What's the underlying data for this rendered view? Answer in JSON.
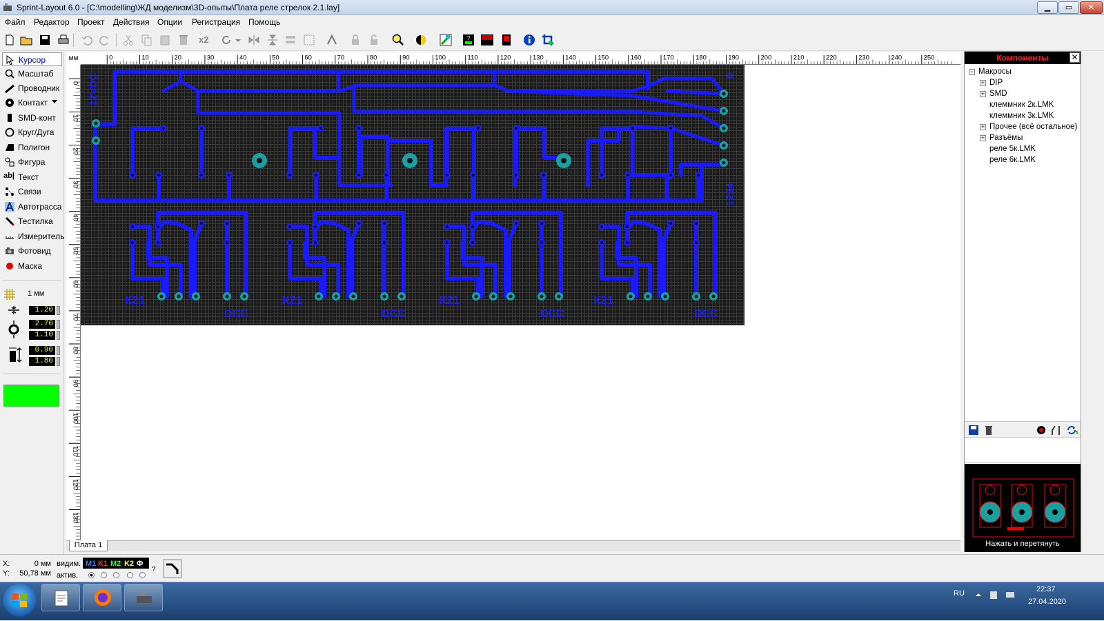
{
  "window": {
    "title": "Sprint-Layout 6.0 - [C:\\modelling\\ЖД моделизм\\3D-опыты\\Плата реле стрелок 2.1.lay]",
    "min": "▁",
    "max": "▭",
    "close": "✕"
  },
  "menu": [
    "Файл",
    "Редактор",
    "Проект",
    "Действия",
    "Опции",
    "Регистрация",
    "Помощь"
  ],
  "toolbar": {
    "zoom_factor": "x2"
  },
  "tools": [
    {
      "label": "Курсор",
      "icon": "cursor-icon",
      "selected": true
    },
    {
      "label": "Масштаб",
      "icon": "magnifier-icon"
    },
    {
      "label": "Проводник",
      "icon": "track-icon"
    },
    {
      "label": "Контакт",
      "icon": "pad-icon",
      "dropdown": true
    },
    {
      "label": "SMD-конт",
      "icon": "smd-pad-icon"
    },
    {
      "label": "Круг/Дуга",
      "icon": "circle-icon"
    },
    {
      "label": "Полигон",
      "icon": "polygon-icon"
    },
    {
      "label": "Фигура",
      "icon": "shape-icon"
    },
    {
      "label": "Текст",
      "icon": "text-icon"
    },
    {
      "label": "Связи",
      "icon": "connections-icon"
    },
    {
      "label": "Автотрасса",
      "icon": "autoroute-icon"
    },
    {
      "label": "Тестилка",
      "icon": "tester-icon"
    },
    {
      "label": "Измеритель",
      "icon": "measure-icon"
    },
    {
      "label": "Фотовид",
      "icon": "photoview-icon"
    },
    {
      "label": "Маска",
      "icon": "mask-icon"
    }
  ],
  "icon_glyphs": {
    "text_tool": "ab|"
  },
  "grid": {
    "label": "1 мм"
  },
  "params": {
    "track_width": "1.20",
    "pad_outer": "2.70",
    "pad_inner": "1.10",
    "smd_w": "0.90",
    "smd_h": "1.80"
  },
  "active_color": "#00ff00",
  "ruler": {
    "unit": "мм",
    "h_ticks": [
      "0",
      "10",
      "20",
      "30",
      "40",
      "50",
      "60",
      "70",
      "80",
      "90",
      "100",
      "110",
      "120",
      "130",
      "140",
      "150",
      "160",
      "170",
      "180",
      "190",
      "200",
      "210",
      "220",
      "230",
      "240",
      "250"
    ],
    "v_ticks": [
      "0",
      "10",
      "20",
      "30",
      "40",
      "50",
      "60",
      "70",
      "80",
      "90",
      "100",
      "110",
      "120",
      "130"
    ]
  },
  "board": {
    "labels": {
      "top_left": "12VDC",
      "top_right": "0",
      "right_side": "1234"
    },
    "section_labels": [
      {
        "k": "К21",
        "d": "DCC"
      },
      {
        "k": "К21",
        "d": "DCC"
      },
      {
        "k": "К21",
        "d": "DCC"
      },
      {
        "k": "К21",
        "d": "DCC"
      }
    ],
    "track_color": "#1a1aff",
    "pad_color": "#1aa0a0",
    "bg": "#202020"
  },
  "sheet_tab": "Плата 1",
  "components": {
    "title": "Компоненты",
    "close": "✕",
    "tree": [
      {
        "label": "Макросы",
        "level": 0,
        "exp": "−"
      },
      {
        "label": "DIP",
        "level": 1,
        "exp": "+"
      },
      {
        "label": "SMD",
        "level": 1,
        "exp": "+"
      },
      {
        "label": "клеммник 2к.LMK",
        "level": 1
      },
      {
        "label": "клеммник 3к.LMK",
        "level": 1
      },
      {
        "label": "Прочее (всё остальное)",
        "level": 1,
        "exp": "+"
      },
      {
        "label": "Разъёмы",
        "level": 1,
        "exp": "+"
      },
      {
        "label": "реле 5к.LMK",
        "level": 1
      },
      {
        "label": "реле 6к.LMK",
        "level": 1
      }
    ],
    "preview_caption": "Нажать и перетянуть"
  },
  "status": {
    "x_label": "X:",
    "x_value": "0 мм",
    "y_label": "Y:",
    "y_value": "50,78 мм",
    "vis_label": "видим.",
    "act_label": "актив.",
    "layers": [
      {
        "name": "M1",
        "color": "#3a7bff"
      },
      {
        "name": "K1",
        "color": "#ff3030"
      },
      {
        "name": "M2",
        "color": "#30ff30"
      },
      {
        "name": "K2",
        "color": "#ffff30"
      },
      {
        "name": "Ф",
        "color": "#ffffff"
      }
    ],
    "help": "?"
  },
  "tray": {
    "lang": "RU",
    "time": "22:37",
    "date": "27.04.2020"
  }
}
